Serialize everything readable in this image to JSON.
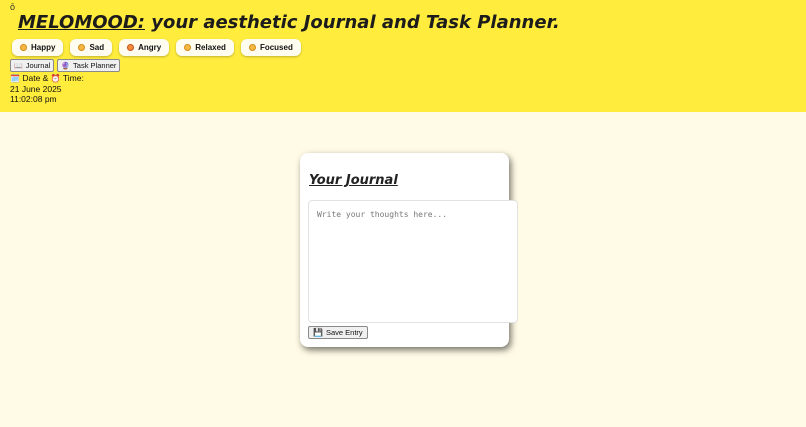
{
  "header": {
    "corner_glyph": "ō",
    "brand": "MELOMOOD:",
    "tagline": " your aesthetic Journal and Task Planner."
  },
  "moods": [
    {
      "label": "Happy",
      "icon": "smile-icon"
    },
    {
      "label": "Sad",
      "icon": "sad-face-icon"
    },
    {
      "label": "Angry",
      "icon": "angry-face-icon"
    },
    {
      "label": "Relaxed",
      "icon": "relaxed-face-icon"
    },
    {
      "label": "Focused",
      "icon": "focused-face-icon"
    }
  ],
  "nav": {
    "journal_icon": "📖",
    "journal_label": "Journal",
    "planner_icon": "🔮",
    "planner_label": "Task Planner"
  },
  "datetime": {
    "calendar_icon": "🗓️",
    "date_label": "Date &",
    "alarm_icon": "⏰",
    "time_label": "Time:",
    "date": "21 June 2025",
    "time": "11:02:08 pm"
  },
  "journal": {
    "title": "Your Journal",
    "placeholder": "Write your thoughts here...",
    "save_icon": "💾",
    "save_label": "Save Entry"
  },
  "colors": {
    "header_bg": "#ffec3d",
    "page_bg": "#fffbe6",
    "card_bg": "#ffffff"
  }
}
